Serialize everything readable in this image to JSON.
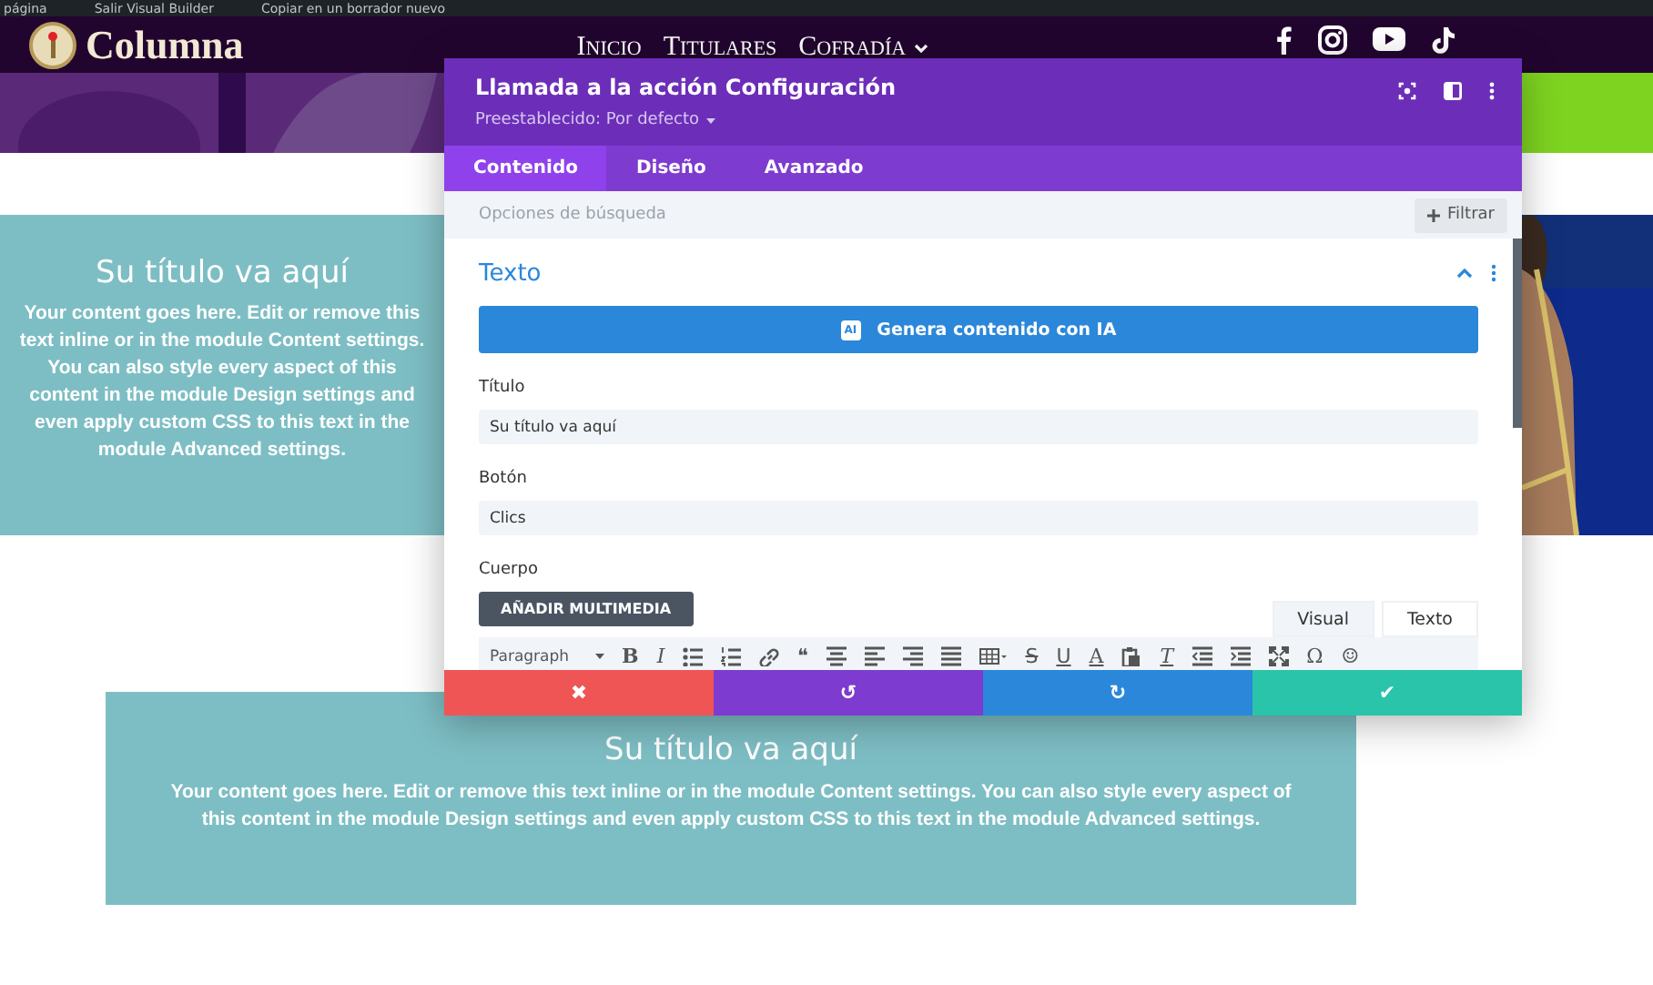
{
  "admin_bar": {
    "items": [
      "página",
      "Salir Visual Builder",
      "Copiar en un borrador nuevo"
    ]
  },
  "header": {
    "logo_text": "Columna",
    "nav": [
      {
        "label": "Inicio",
        "has_dropdown": false
      },
      {
        "label": "Titulares",
        "has_dropdown": false
      },
      {
        "label": "Cofradía",
        "has_dropdown": true
      }
    ]
  },
  "cta_left": {
    "title": "Su título va aquí",
    "body": "Your content goes here. Edit or remove this text inline or in the module Content settings. You can also style every aspect of this content in the module Design settings and even apply custom CSS to this text in the module Advanced settings."
  },
  "cta_bottom": {
    "title": "Su título va aquí",
    "body": "Your content goes here. Edit or remove this text inline or in the module Content settings. You can also style every aspect of this content in the module Design settings and even apply custom CSS to this text in the module Advanced settings."
  },
  "modal": {
    "title": "Llamada a la acción Configuración",
    "preset": "Preestablecido: Por defecto",
    "tabs": [
      {
        "label": "Contenido",
        "selected": true
      },
      {
        "label": "Diseño",
        "selected": false
      },
      {
        "label": "Avanzado",
        "selected": false
      }
    ],
    "search": {
      "placeholder": "Opciones de búsqueda"
    },
    "filter_button": "Filtrar",
    "section": {
      "title": "Texto",
      "expanded": true
    },
    "ai_badge": "AI",
    "ai_button": "Genera contenido con IA",
    "fields": [
      {
        "label": "Título",
        "value": "Su título va aquí"
      },
      {
        "label": "Botón",
        "value": "Clics"
      }
    ],
    "body_label": "Cuerpo",
    "media_button": "AÑADIR MULTIMEDIA",
    "editor_tabs": [
      {
        "label": "Visual",
        "selected": true
      },
      {
        "label": "Texto",
        "selected": false
      }
    ],
    "toolbar": [
      {
        "kind": "select",
        "text": "Paragraph"
      },
      {
        "kind": "glyph",
        "text": "B"
      },
      {
        "kind": "glyph",
        "text": "I"
      },
      {
        "kind": "svg"
      },
      {
        "kind": "svg"
      },
      {
        "kind": "svg"
      },
      {
        "kind": "glyph",
        "text": "❝"
      },
      {
        "kind": "svg"
      },
      {
        "kind": "svg"
      },
      {
        "kind": "svg"
      },
      {
        "kind": "svg"
      },
      {
        "kind": "svg"
      },
      {
        "kind": "glyph",
        "text": "S"
      },
      {
        "kind": "glyph",
        "text": "U"
      },
      {
        "kind": "glyph",
        "text": "A"
      },
      {
        "kind": "svg"
      },
      {
        "kind": "glyph",
        "text": "T"
      },
      {
        "kind": "svg"
      },
      {
        "kind": "svg"
      },
      {
        "kind": "svg"
      },
      {
        "kind": "glyph",
        "text": "Ω"
      },
      {
        "kind": "glyph",
        "text": "☺"
      }
    ],
    "footer": [
      {
        "kind": "cancel",
        "text": "✖"
      },
      {
        "kind": "undo",
        "text": "↺"
      },
      {
        "kind": "redo",
        "text": "↻"
      },
      {
        "kind": "save",
        "text": "✔"
      }
    ]
  }
}
